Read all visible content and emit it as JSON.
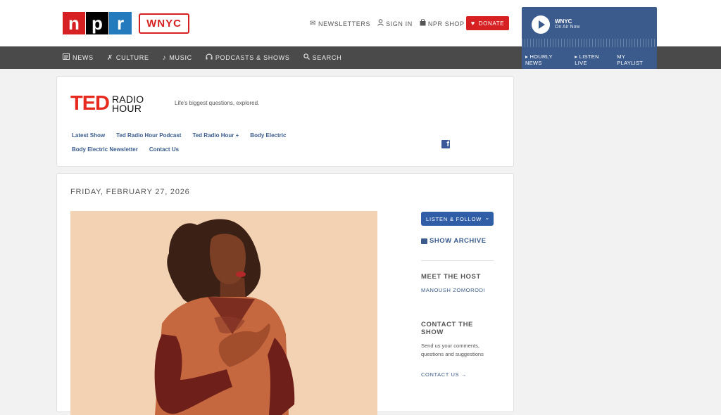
{
  "header": {
    "npr_letters": [
      "n",
      "p",
      "r"
    ],
    "wnyc_logo": "WNYC",
    "utility": [
      {
        "label": "NEWSLETTERS",
        "icon": "envelope-icon"
      },
      {
        "label": "SIGN IN",
        "icon": "user-icon"
      },
      {
        "label": "NPR SHOP",
        "icon": "shopping-bag-icon"
      }
    ],
    "donate_label": "DONATE"
  },
  "player": {
    "station": "WNYC",
    "status": "On Air Now",
    "links": [
      "▸ HOURLY NEWS",
      "▸ LISTEN LIVE",
      "MY PLAYLIST"
    ]
  },
  "nav": {
    "items": [
      {
        "label": "NEWS",
        "icon": "newspaper-icon"
      },
      {
        "label": "CULTURE",
        "icon": "culture-icon"
      },
      {
        "label": "MUSIC",
        "icon": "music-note-icon"
      },
      {
        "label": "PODCASTS & SHOWS",
        "icon": "headphones-icon"
      },
      {
        "label": "SEARCH",
        "icon": "search-icon"
      }
    ]
  },
  "show": {
    "logo_ted": "TED",
    "logo_line1": "RADIO",
    "logo_line2": "HOUR",
    "tagline": "Life's biggest questions, explored.",
    "links_row1": [
      "Latest Show",
      "Ted Radio Hour Podcast",
      "Ted Radio Hour +",
      "Body Electric"
    ],
    "links_row2": [
      "Body Electric Newsletter",
      "Contact Us"
    ]
  },
  "episode": {
    "date": "FRIDAY, FEBRUARY 27, 2026"
  },
  "sidebar": {
    "listen_follow": "LISTEN & FOLLOW",
    "show_archive": "SHOW ARCHIVE",
    "meet_host_heading": "MEET THE HOST",
    "host_name": "MANOUSH ZOMORODI",
    "contact_heading_line1": "CONTACT THE",
    "contact_heading_line2": "SHOW",
    "contact_text": "Send us your comments, questions and suggestions",
    "contact_link": "CONTACT US →"
  },
  "colors": {
    "npr_red": "#d62021",
    "npr_blue": "#237bbd",
    "ted_red": "#e62b1e",
    "link_blue": "#3a5b8c",
    "nav_bg": "#4a4a4a",
    "player_bg": "#3a5b8c",
    "illustration_bg": "#f3d2b4"
  }
}
